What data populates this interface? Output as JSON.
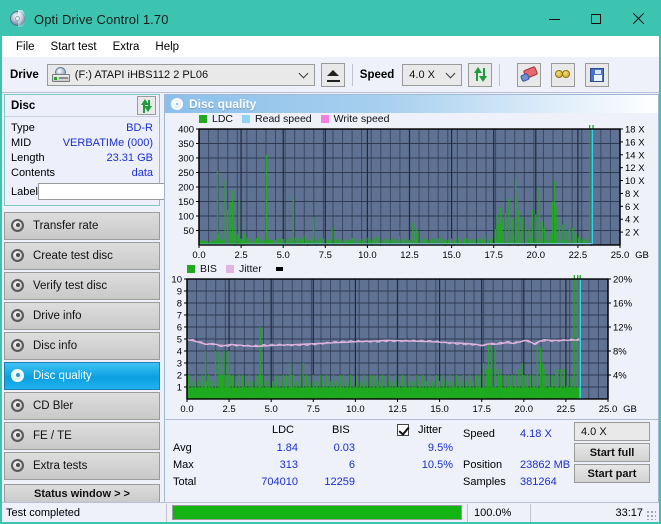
{
  "window": {
    "title": "Opti Drive Control 1.70",
    "icon": "disc-icon",
    "minimize": "–",
    "maximize": "□",
    "close": "✕",
    "titlebar_color": "#3cc4b0"
  },
  "menu": [
    {
      "label": "File"
    },
    {
      "label": "Start test"
    },
    {
      "label": "Extra"
    },
    {
      "label": "Help"
    }
  ],
  "toolbar": {
    "drive_label": "Drive",
    "drive_value": "(F:)  ATAPI iHBS112  2 PL06",
    "eject_name": "eject-button",
    "speed_label": "Speed",
    "speed_value": "4.0 X",
    "refresh_name": "refresh-button",
    "erase_name": "erase-button",
    "glasses_name": "glasses-button",
    "save_name": "save-button"
  },
  "disc_panel": {
    "title": "Disc",
    "refresh_name": "disc-refresh-button",
    "rows": [
      {
        "key": "Type",
        "value": "BD-R"
      },
      {
        "key": "MID",
        "value": "VERBATIMe (000)"
      },
      {
        "key": "Length",
        "value": "23.31 GB"
      },
      {
        "key": "Contents",
        "value": "data"
      }
    ],
    "label_key": "Label",
    "label_value": "",
    "label_placeholder": ""
  },
  "nav": {
    "items": [
      {
        "label": "Transfer rate",
        "active": false
      },
      {
        "label": "Create test disc",
        "active": false
      },
      {
        "label": "Verify test disc",
        "active": false
      },
      {
        "label": "Drive info",
        "active": false
      },
      {
        "label": "Disc info",
        "active": false
      },
      {
        "label": "Disc quality",
        "active": true
      },
      {
        "label": "CD Bler",
        "active": false
      },
      {
        "label": "FE / TE",
        "active": false
      },
      {
        "label": "Extra tests",
        "active": false
      }
    ],
    "status_window": "Status window > >"
  },
  "content": {
    "header": "Disc quality",
    "header_icon": "disc-quality-icon"
  },
  "stats": {
    "col_headers": [
      "LDC",
      "BIS"
    ],
    "row_headers": [
      "Avg",
      "Max",
      "Total"
    ],
    "ldc": {
      "avg": "1.84",
      "max": "313",
      "total": "704010"
    },
    "bis": {
      "avg": "0.03",
      "max": "6",
      "total": "12259"
    },
    "jitter_label": "Jitter",
    "jitter_checked": true,
    "jitter_avg": "9.5%",
    "jitter_max": "10.5%",
    "speed_label": "Speed",
    "speed_value": "4.18 X",
    "position_label": "Position",
    "position_value": "23862 MB",
    "samples_label": "Samples",
    "samples_value": "381264",
    "speed_select": "4.0 X",
    "start_full": "Start full",
    "start_part": "Start part"
  },
  "statusbar": {
    "message": "Test completed",
    "progress_percent": "100.0%",
    "progress_value": 100,
    "elapsed": "33:17"
  },
  "chart_data": [
    {
      "type": "line",
      "name": "ldc-chart",
      "title": "",
      "xlabel": "GB",
      "ylabel": "",
      "xlim": [
        0,
        25
      ],
      "xticks": [
        "0.0",
        "2.5",
        "5.0",
        "7.5",
        "10.0",
        "12.5",
        "15.0",
        "17.5",
        "20.0",
        "22.5",
        "25.0"
      ],
      "xunit": "GB",
      "ylim": [
        0,
        400
      ],
      "yticks": [
        "50",
        "100",
        "150",
        "200",
        "250",
        "300",
        "350",
        "400"
      ],
      "y2lim": [
        0,
        18
      ],
      "y2ticks": [
        "2 X",
        "4 X",
        "6 X",
        "8 X",
        "10 X",
        "12 X",
        "14 X",
        "16 X",
        "18 X"
      ],
      "grid": true,
      "legend": [
        {
          "label": "LDC",
          "color": "#1faa1f"
        },
        {
          "label": "Read speed",
          "color": "#8fd4f5"
        },
        {
          "label": "Write speed",
          "color": "#f57ce0"
        }
      ],
      "series": [
        {
          "name": "LDC",
          "color": "#1faa1f",
          "kind": "spikes",
          "x": [
            0.05,
            0.2,
            0.35,
            0.5,
            0.65,
            0.8,
            0.95,
            1.1,
            1.15,
            1.25,
            1.4,
            1.55,
            1.7,
            1.85,
            2.0,
            2.15,
            2.2,
            2.3,
            2.4,
            2.5,
            2.6,
            2.7,
            2.85,
            3.0,
            3.1,
            3.25,
            3.4,
            3.55,
            3.7,
            3.85,
            4.0,
            4.15,
            4.3,
            4.4,
            4.55,
            4.7,
            4.85,
            5.0,
            5.2,
            5.4,
            5.6,
            5.75,
            5.85,
            6.0,
            6.15,
            6.3,
            6.45,
            6.6,
            6.8,
            7.0,
            7.2,
            7.4,
            7.6,
            7.8,
            7.9,
            8.1,
            8.3,
            8.5,
            8.7,
            8.9,
            9.1,
            9.3,
            9.5,
            9.7,
            9.9,
            10.1,
            10.3,
            10.5,
            10.7,
            10.9,
            11.1,
            11.3,
            11.5,
            11.7,
            11.9,
            12.1,
            12.3,
            12.5,
            12.7,
            12.9,
            13.0,
            13.2,
            13.4,
            13.6,
            13.8,
            14.0,
            14.2,
            14.4,
            14.6,
            14.8,
            15.0,
            15.2,
            15.4,
            15.6,
            15.8,
            16.0,
            16.2,
            16.4,
            16.6,
            16.8,
            17.0,
            17.2,
            17.4,
            17.6,
            17.7,
            17.8,
            17.9,
            18.0,
            18.2,
            18.4,
            18.6,
            18.8,
            18.9,
            19.0,
            19.2,
            19.4,
            19.6,
            19.8,
            20.0,
            20.2,
            20.4,
            20.5,
            20.7,
            20.9,
            21.0,
            21.1,
            21.2,
            21.4,
            21.6,
            21.8,
            22.0,
            22.2,
            22.4,
            22.6,
            22.8,
            23.0,
            23.2,
            23.4
          ],
          "y": [
            12,
            15,
            10,
            14,
            11,
            13,
            16,
            255,
            40,
            18,
            14,
            225,
            120,
            150,
            188,
            60,
            35,
            40,
            160,
            22,
            18,
            40,
            25,
            15,
            20,
            18,
            22,
            30,
            14,
            18,
            312,
            20,
            16,
            14,
            18,
            22,
            15,
            20,
            18,
            24,
            168,
            30,
            22,
            18,
            26,
            35,
            18,
            14,
            96,
            20,
            18,
            22,
            16,
            14,
            60,
            18,
            22,
            16,
            20,
            18,
            24,
            16,
            20,
            18,
            22,
            16,
            20,
            18,
            24,
            16,
            20,
            18,
            22,
            16,
            30,
            18,
            20,
            16,
            78,
            55,
            40,
            18,
            22,
            16,
            20,
            18,
            24,
            16,
            20,
            18,
            22,
            16,
            20,
            18,
            24,
            16,
            20,
            18,
            22,
            16,
            35,
            20,
            28,
            55,
            105,
            70,
            130,
            85,
            110,
            160,
            90,
            230,
            165,
            120,
            95,
            70,
            55,
            120,
            105,
            200,
            80,
            60,
            45,
            38,
            150,
            220,
            130,
            90,
            70,
            50,
            85,
            60,
            40,
            30,
            22,
            18
          ]
        },
        {
          "name": "Read speed",
          "color": "#8fd4f5",
          "kind": "line",
          "x": [
            0.0,
            0.3,
            0.7,
            1.2,
            1.8,
            2.4,
            3.0,
            3.8,
            4.6,
            5.4,
            6.2,
            7.0,
            7.8,
            8.6,
            9.4,
            10.2,
            11.0,
            11.8,
            12.6,
            13.4,
            14.2,
            15.0,
            15.8,
            16.6,
            17.4,
            17.6,
            18.4,
            19.2,
            20.0,
            20.8,
            21.6,
            22.4,
            23.3
          ],
          "y": [
            1.9,
            2.0,
            2.1,
            2.15,
            2.2,
            2.25,
            2.3,
            2.4,
            2.55,
            2.7,
            2.8,
            2.9,
            3.0,
            3.05,
            3.1,
            3.15,
            3.2,
            3.25,
            3.3,
            3.33,
            3.36,
            3.4,
            3.45,
            3.5,
            3.55,
            3.9,
            3.92,
            3.94,
            3.96,
            3.98,
            4.0,
            4.05,
            4.1
          ]
        }
      ],
      "cursor_x": 23.35,
      "cursor_color": "#35d0f0"
    },
    {
      "type": "line",
      "name": "bis-chart",
      "title": "",
      "xlabel": "GB",
      "ylabel": "",
      "xlim": [
        0,
        25
      ],
      "xticks": [
        "0.0",
        "2.5",
        "5.0",
        "7.5",
        "10.0",
        "12.5",
        "15.0",
        "17.5",
        "20.0",
        "22.5",
        "25.0"
      ],
      "xunit": "GB",
      "ylim": [
        0,
        10
      ],
      "yticks": [
        "1",
        "2",
        "3",
        "4",
        "5",
        "6",
        "7",
        "8",
        "9",
        "10"
      ],
      "y2lim": [
        0,
        20
      ],
      "y2ticks": [
        "4%",
        "8%",
        "12%",
        "16%",
        "20%"
      ],
      "grid": true,
      "legend": [
        {
          "label": "BIS",
          "color": "#1faa1f"
        },
        {
          "label": "Jitter",
          "color": "#e8b8e8"
        }
      ],
      "series": [
        {
          "name": "BIS",
          "color": "#1faa1f",
          "kind": "spikes",
          "x": [
            0.1,
            0.3,
            0.5,
            0.7,
            0.9,
            1.1,
            1.15,
            1.3,
            1.5,
            1.7,
            1.9,
            2.0,
            2.05,
            2.1,
            2.2,
            2.3,
            2.4,
            2.5,
            2.55,
            2.7,
            2.9,
            3.1,
            3.3,
            3.5,
            3.7,
            3.9,
            4.1,
            4.3,
            4.35,
            4.5,
            4.7,
            4.9,
            5.1,
            5.3,
            5.5,
            5.7,
            5.9,
            6.1,
            6.2,
            6.3,
            6.5,
            6.7,
            6.9,
            7.1,
            7.3,
            7.5,
            7.7,
            7.9,
            8.1,
            8.3,
            8.5,
            8.7,
            8.9,
            9.1,
            9.3,
            9.5,
            9.7,
            9.9,
            10.1,
            10.3,
            10.5,
            10.7,
            10.9,
            11.1,
            11.3,
            11.4,
            11.6,
            11.8,
            12.0,
            12.2,
            12.4,
            12.6,
            12.8,
            13.0,
            13.2,
            13.4,
            13.6,
            13.8,
            14.0,
            14.2,
            14.4,
            14.6,
            14.8,
            15.0,
            15.2,
            15.4,
            15.6,
            15.8,
            16.0,
            16.2,
            16.4,
            16.6,
            16.8,
            17.0,
            17.2,
            17.4,
            17.6,
            17.8,
            17.9,
            18.0,
            18.1,
            18.3,
            18.5,
            18.6,
            18.7,
            18.9,
            19.1,
            19.3,
            19.5,
            19.7,
            19.9,
            20.0,
            20.2,
            20.4,
            20.6,
            20.8,
            21.0,
            21.1,
            21.2,
            21.3,
            21.5,
            21.7,
            21.9,
            22.0,
            22.2,
            22.4,
            22.6,
            22.8,
            23.0,
            23.2,
            23.35
          ],
          "y": [
            2,
            1.5,
            2,
            1.5,
            2,
            4,
            1.5,
            2,
            1.5,
            4,
            4,
            2,
            3.5,
            2,
            4,
            2,
            2,
            4,
            2,
            2,
            1.5,
            2,
            2,
            1.5,
            2,
            1.5,
            2,
            2,
            6,
            2,
            1.5,
            2,
            1.5,
            2,
            1.5,
            2,
            2,
            3,
            2,
            2,
            1.5,
            2,
            3,
            2,
            1.5,
            2,
            1.5,
            2,
            1.5,
            2,
            1.5,
            2,
            1.5,
            2,
            2,
            1.5,
            2,
            1.5,
            2,
            1.5,
            2,
            1.5,
            2,
            2,
            2,
            1.5,
            2,
            1.5,
            2,
            1.5,
            2,
            1.5,
            2,
            1.5,
            2,
            1.5,
            2,
            1.5,
            2,
            1.5,
            2,
            1.5,
            2,
            1.5,
            2,
            1.5,
            2,
            1.5,
            2,
            1.5,
            2,
            1.5,
            2,
            1.5,
            2,
            2,
            3,
            2.5,
            4.5,
            2.5,
            4.5,
            4.2,
            2.5,
            2,
            2,
            2,
            2,
            2,
            2,
            2.5,
            3,
            2,
            2,
            2,
            2,
            4.5,
            4.3,
            3,
            2.5,
            2,
            2,
            2,
            2.5,
            2.5,
            2.5,
            2.5,
            2,
            1.8
          ]
        },
        {
          "name": "Jitter",
          "color": "#e0b4dd",
          "kind": "line",
          "x": [
            0.0,
            0.2,
            0.5,
            0.9,
            1.2,
            1.5,
            1.9,
            2.2,
            2.6,
            3.0,
            3.4,
            3.8,
            4.2,
            4.6,
            5.0,
            5.4,
            5.8,
            6.2,
            6.6,
            7.0,
            7.4,
            7.8,
            8.2,
            8.6,
            9.0,
            9.4,
            9.8,
            10.2,
            10.6,
            11.0,
            11.4,
            11.8,
            12.2,
            12.6,
            13.0,
            13.4,
            13.8,
            14.2,
            14.6,
            15.0,
            15.4,
            15.8,
            16.2,
            16.6,
            17.0,
            17.4,
            17.6,
            17.9,
            18.2,
            18.6,
            19.0,
            19.4,
            19.8,
            20.2,
            20.6,
            21.0,
            21.2,
            21.6,
            22.0,
            22.4,
            22.8,
            23.2,
            23.35
          ],
          "y": [
            4.95,
            4.9,
            4.8,
            4.65,
            4.55,
            4.62,
            4.5,
            4.45,
            4.55,
            4.5,
            4.45,
            4.4,
            4.38,
            4.42,
            4.45,
            4.48,
            4.5,
            4.52,
            4.55,
            4.58,
            4.6,
            4.62,
            4.65,
            4.68,
            4.7,
            4.72,
            4.75,
            4.78,
            4.8,
            4.82,
            4.85,
            4.9,
            4.88,
            4.86,
            4.84,
            4.82,
            4.8,
            4.78,
            4.76,
            4.74,
            4.7,
            4.68,
            4.66,
            4.62,
            4.58,
            4.5,
            4.45,
            4.6,
            4.55,
            4.6,
            4.7,
            4.62,
            4.78,
            4.9,
            4.6,
            4.85,
            4.95,
            4.9,
            4.88,
            4.9,
            4.9,
            4.92,
            4.9
          ]
        }
      ],
      "cursor_x": 23.35,
      "cursor_color": "#35d0f0"
    }
  ]
}
